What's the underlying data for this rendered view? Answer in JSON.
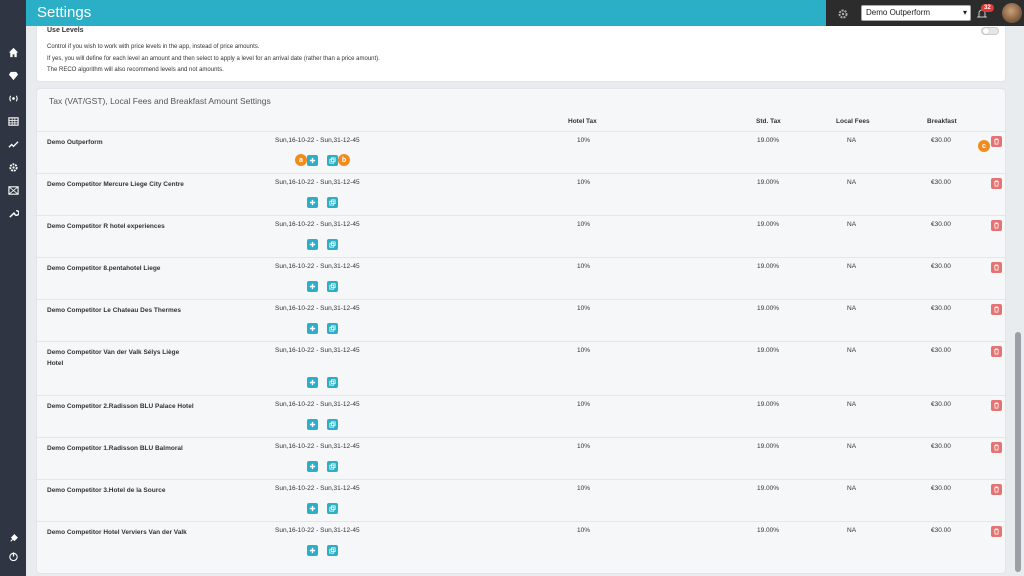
{
  "header": {
    "title": "Settings",
    "hotel_select": "Demo Outperform",
    "notification_count": "32"
  },
  "use_levels": {
    "title": "Use Levels",
    "lines": [
      "Control if you wish to work with price levels in the app, instead of price amounts.",
      "If yes, you will define for each level an amount and then select to apply a level for an arrival date (rather than a price amount).",
      "The RECO algorithm will also recommend levels and not amounts."
    ]
  },
  "tax_section": {
    "title": "Tax (VAT/GST), Local Fees and Breakfast Amount Settings",
    "columns": {
      "hotel_tax": "Hotel Tax",
      "std_tax": "Std. Tax",
      "local_fees": "Local Fees",
      "breakfast": "Breakfast"
    },
    "rows": [
      {
        "name": "Demo Outperform",
        "period": "Sun,16-10-22 - Sun,31-12-45",
        "hotel_tax": "10%",
        "std_tax": "19.00%",
        "local_fees": "NA",
        "breakfast": "€30.00"
      },
      {
        "name": "Demo Competitor Mercure Liege City Centre",
        "period": "Sun,16-10-22 - Sun,31-12-45",
        "hotel_tax": "10%",
        "std_tax": "19.00%",
        "local_fees": "NA",
        "breakfast": "€30.00"
      },
      {
        "name": "Demo Competitor R hotel experiences",
        "period": "Sun,16-10-22 - Sun,31-12-45",
        "hotel_tax": "10%",
        "std_tax": "19.00%",
        "local_fees": "NA",
        "breakfast": "€30.00"
      },
      {
        "name": "Demo Competitor 8.pentahotel Liege",
        "period": "Sun,16-10-22 - Sun,31-12-45",
        "hotel_tax": "10%",
        "std_tax": "19.00%",
        "local_fees": "NA",
        "breakfast": "€30.00"
      },
      {
        "name": "Demo Competitor Le Chateau Des Thermes",
        "period": "Sun,16-10-22 - Sun,31-12-45",
        "hotel_tax": "10%",
        "std_tax": "19.00%",
        "local_fees": "NA",
        "breakfast": "€30.00"
      },
      {
        "name": "Demo Competitor Van der Valk Sélys Liège Hotel",
        "period": "Sun,16-10-22 - Sun,31-12-45",
        "hotel_tax": "10%",
        "std_tax": "19.00%",
        "local_fees": "NA",
        "breakfast": "€30.00"
      },
      {
        "name": "Demo Competitor 2.Radisson BLU Palace Hotel",
        "period": "Sun,16-10-22 - Sun,31-12-45",
        "hotel_tax": "10%",
        "std_tax": "19.00%",
        "local_fees": "NA",
        "breakfast": "€30.00"
      },
      {
        "name": "Demo Competitor 1.Radisson BLU Balmoral",
        "period": "Sun,16-10-22 - Sun,31-12-45",
        "hotel_tax": "10%",
        "std_tax": "19.00%",
        "local_fees": "NA",
        "breakfast": "€30.00"
      },
      {
        "name": "Demo Competitor 3.Hotel de la Source",
        "period": "Sun,16-10-22 - Sun,31-12-45",
        "hotel_tax": "10%",
        "std_tax": "19.00%",
        "local_fees": "NA",
        "breakfast": "€30.00"
      },
      {
        "name": "Demo Competitor Hotel Verviers Van der Valk",
        "period": "Sun,16-10-22 - Sun,31-12-45",
        "hotel_tax": "10%",
        "std_tax": "19.00%",
        "local_fees": "NA",
        "breakfast": "€30.00"
      }
    ]
  },
  "markers": {
    "a": "a",
    "b": "b",
    "c": "c"
  },
  "colors": {
    "accent": "#2bafc6",
    "delete": "#e57373",
    "sidebar": "#2f3542",
    "marker": "#f08c1e"
  },
  "icons": {
    "sidebar": [
      "home-icon",
      "diamond-icon",
      "broadcast-icon",
      "table-icon",
      "chart-line-icon",
      "gear-icon",
      "image-icon",
      "wrench-icon",
      "plug-icon",
      "power-icon"
    ]
  }
}
